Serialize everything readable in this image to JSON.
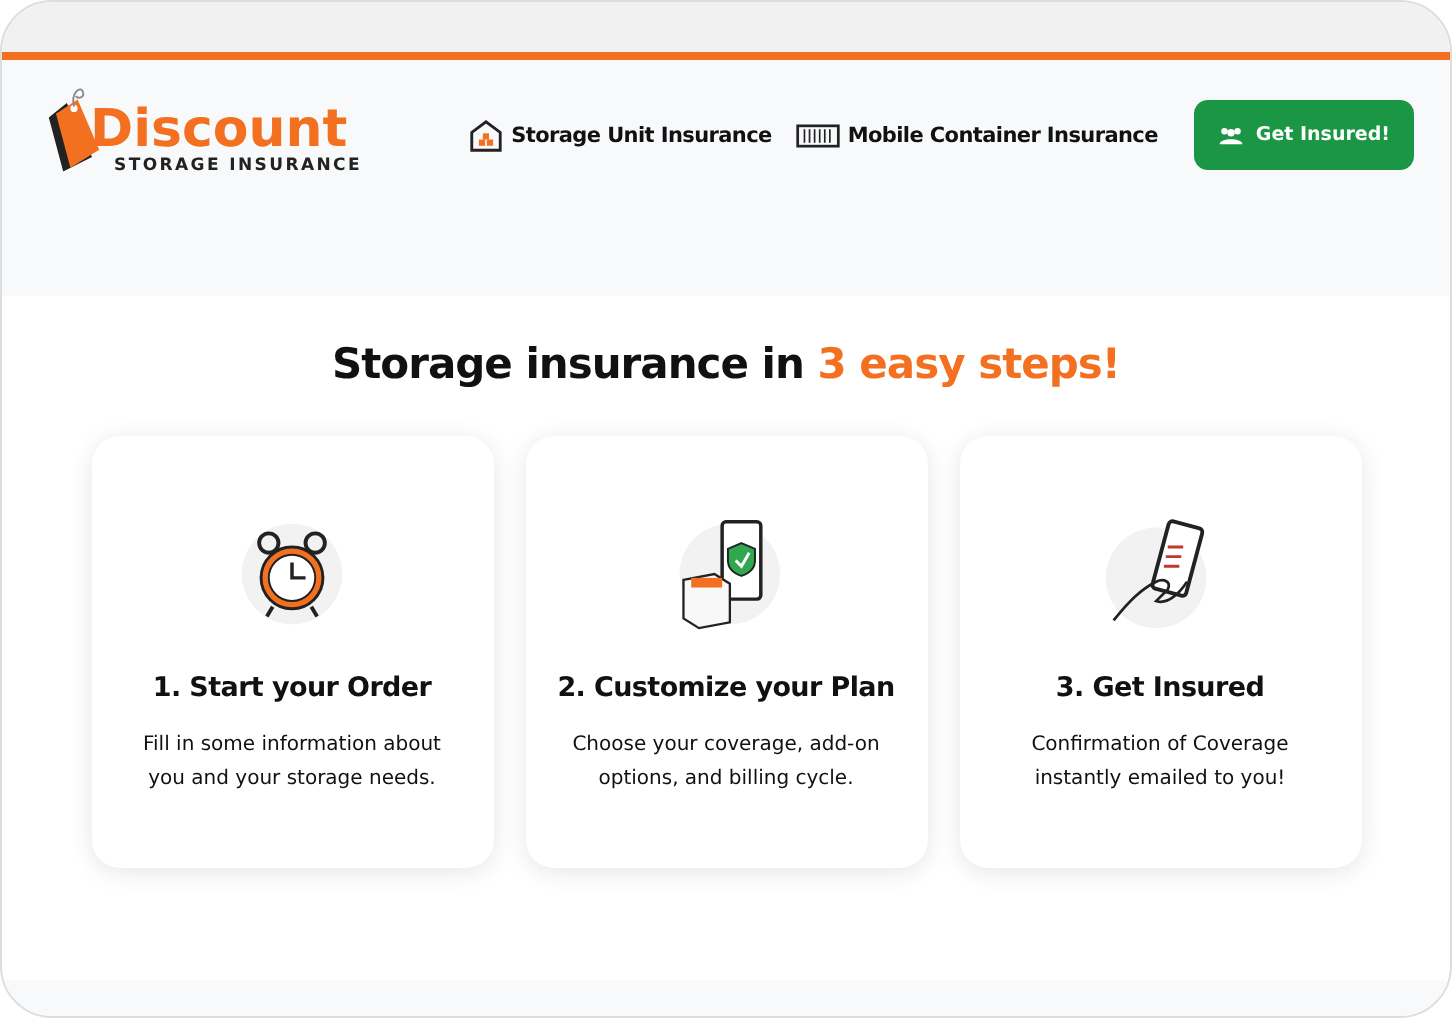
{
  "logo": {
    "name": "Discount",
    "tagline": "STORAGE INSURANCE"
  },
  "nav": [
    {
      "kind": "warehouse",
      "label": "Storage Unit Insurance"
    },
    {
      "kind": "container",
      "label": "Mobile Container Insurance"
    }
  ],
  "cta": {
    "label": "Get Insured!"
  },
  "heading": {
    "text": "Storage insurance in",
    "highlight": "3 easy steps!"
  },
  "steps": [
    {
      "kind": "clock",
      "title": "1. Start your Order",
      "text": "Fill in some information about you and your storage needs."
    },
    {
      "kind": "phone-box",
      "title": "2. Customize your Plan",
      "text": "Choose your coverage, add-on options, and billing cycle."
    },
    {
      "kind": "phone-hand",
      "title": "3. Get Insured",
      "text": "Confirmation of Coverage instantly emailed to you!"
    }
  ]
}
